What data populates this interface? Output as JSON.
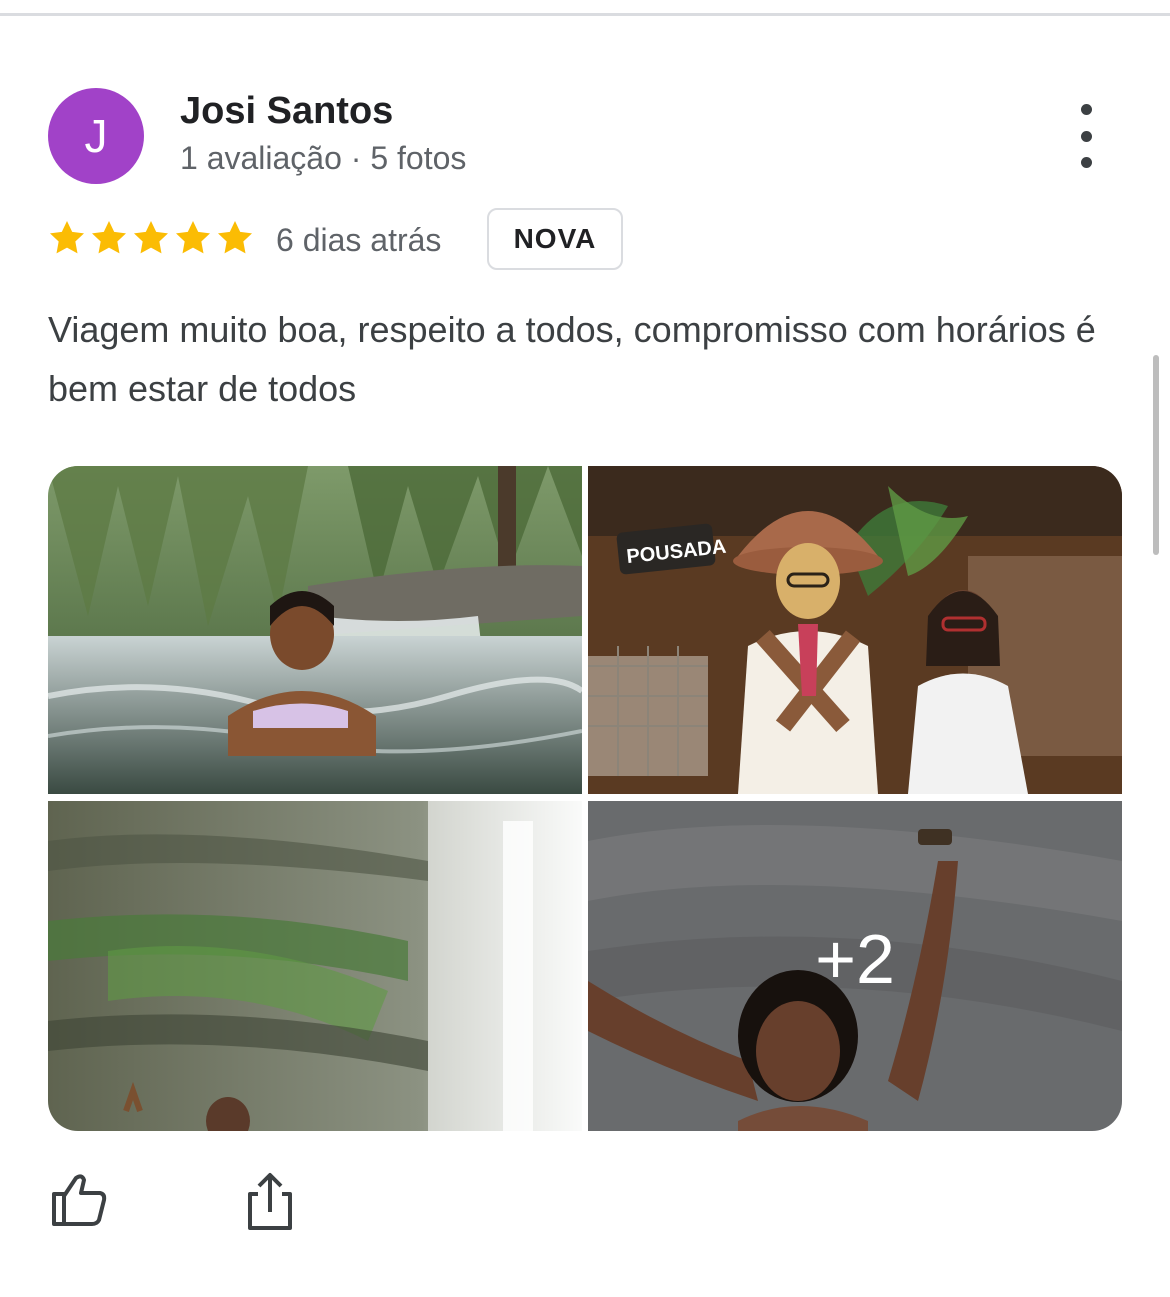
{
  "reviewer": {
    "initial": "J",
    "name": "Josi Santos",
    "meta": "1 avaliação · 5 fotos",
    "avatar_color": "#a142c8"
  },
  "review": {
    "rating": 5,
    "max_rating": 5,
    "date": "6 dias atrás",
    "badge": "NOVA",
    "text": "Viagem muito boa, respeito a todos, compromisso com horários é bem estar de todos"
  },
  "photos": {
    "items": [
      {
        "name": "waterfall-pool-photo"
      },
      {
        "name": "pousada-statue-photo"
      },
      {
        "name": "cave-waterfall-photo"
      },
      {
        "name": "arms-raised-photo"
      }
    ],
    "more_count_label": "+2",
    "sign_text": "POUSADA"
  },
  "actions": {
    "like_icon": "thumb-up-icon",
    "share_icon": "share-icon"
  },
  "colors": {
    "star": "#fbbc04",
    "text_primary": "#202124",
    "text_secondary": "#5f6368"
  }
}
